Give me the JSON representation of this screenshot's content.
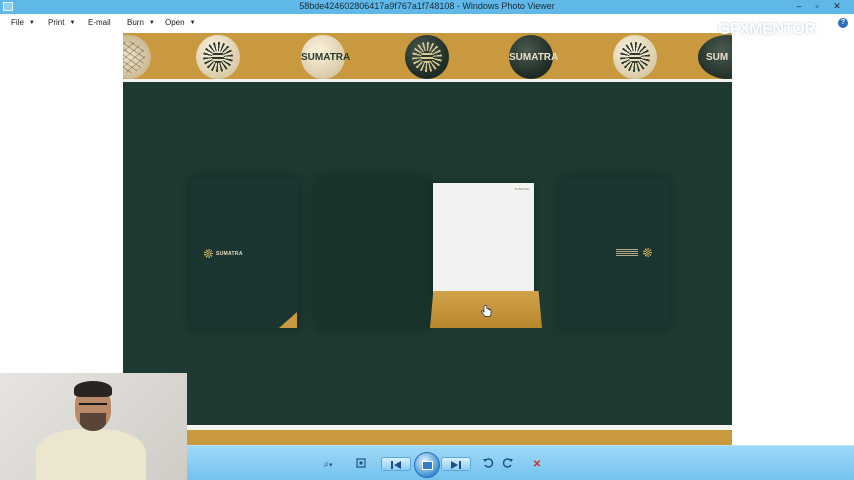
{
  "window": {
    "title": "58bde424602806417a9f767a1f748108 - Windows Photo Viewer",
    "minimize_glyph": "–",
    "maximize_glyph": "▫",
    "close_glyph": "✕"
  },
  "menu": {
    "file": "File",
    "print": "Print",
    "email": "E-mail",
    "burn": "Burn",
    "open": "Open",
    "help_glyph": "?"
  },
  "watermark": {
    "text": "GFXMENTOR"
  },
  "image": {
    "banner_badges": [
      {
        "style": "crackle",
        "text": ""
      },
      {
        "style": "light-sun",
        "text": ""
      },
      {
        "style": "light",
        "text": "SUMATRA"
      },
      {
        "style": "dark-sun",
        "text": ""
      },
      {
        "style": "dark",
        "text": "SUMATRA"
      },
      {
        "style": "light-sun",
        "text": ""
      },
      {
        "style": "dark-partial",
        "text": "SUM"
      }
    ],
    "folder_logo_text": "SUMATRA",
    "paper_logo_text": "SUMATRA"
  },
  "toolbar": {
    "zoom_icon": "zoom-icon",
    "fit_icon": "actual-size-icon",
    "prev_icon": "previous-icon",
    "slideshow_icon": "slideshow-icon",
    "next_icon": "next-icon",
    "rotate_ccw_icon": "rotate-counterclockwise-icon",
    "rotate_cw_icon": "rotate-clockwise-icon",
    "delete_icon": "delete-icon",
    "delete_glyph": "✕",
    "zoom_glyph": "⌕",
    "caret_glyph": "▾"
  },
  "colors": {
    "titlebar": "#5fb8e8",
    "toolbar": "#73c3ee",
    "scene_bg": "#1e3a32",
    "gold": "#c9993f"
  }
}
